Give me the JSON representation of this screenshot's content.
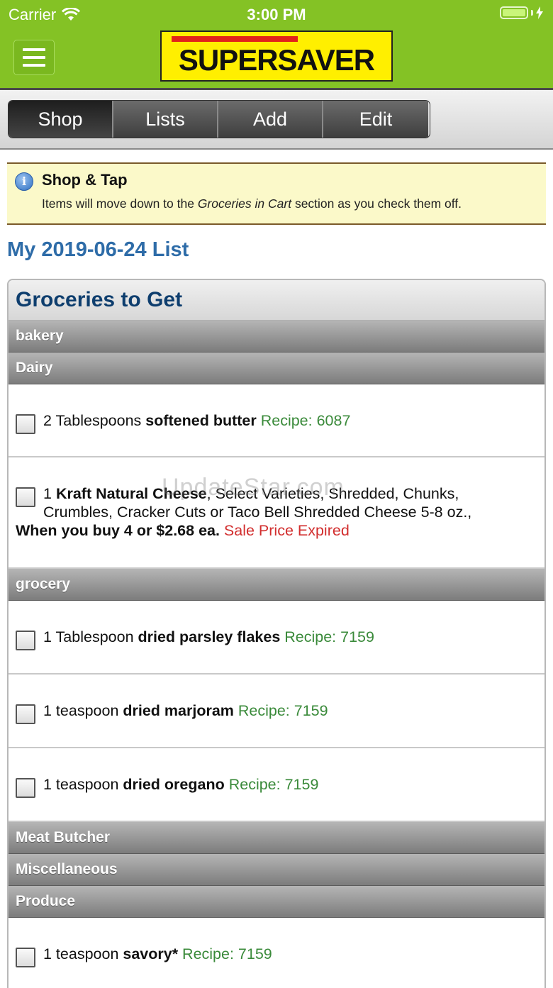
{
  "status_bar": {
    "carrier": "Carrier",
    "time": "3:00 PM",
    "wifi_icon": "wifi-icon",
    "battery_icon": "battery-charging-icon"
  },
  "header": {
    "menu_icon": "hamburger-menu-icon",
    "logo_text": "SUPERSAVER",
    "brand_color": "#84c225",
    "logo_color": "#ffef00"
  },
  "tabs": [
    {
      "label": "Shop",
      "active": true
    },
    {
      "label": "Lists",
      "active": false
    },
    {
      "label": "Add",
      "active": false
    },
    {
      "label": "Edit",
      "active": false
    }
  ],
  "info": {
    "icon": "info-icon",
    "title": "Shop & Tap",
    "text_before": "Items will move down to the ",
    "text_emphasis": "Groceries in Cart",
    "text_after": " section as you check them off."
  },
  "list_title": "My 2019-06-24 List",
  "panel_title": "Groceries to Get",
  "categories": {
    "bakery": "bakery",
    "dairy": "Dairy",
    "grocery": "grocery",
    "meat": "Meat Butcher",
    "misc": "Miscellaneous",
    "produce": "Produce"
  },
  "items": {
    "butter": {
      "qty": "2 Tablespoons ",
      "name": "softened butter",
      "recipe": " Recipe: 6087"
    },
    "cheese": {
      "qty": "1 ",
      "name": "Kraft Natural Cheese",
      "desc_line1": ", Select Varieties, Shredded, Chunks,",
      "desc_line2": "Crumbles, Cracker Cuts or Taco Bell Shredded Cheese 5-8 oz.,",
      "deal": "When you buy 4 or $2.68 ea.",
      "status": " Sale Price Expired"
    },
    "parsley": {
      "qty": "1 Tablespoon ",
      "name": "dried parsley flakes",
      "recipe": " Recipe: 7159"
    },
    "marjoram": {
      "qty": "1 teaspoon ",
      "name": "dried marjoram",
      "recipe": " Recipe: 7159"
    },
    "oregano": {
      "qty": "1 teaspoon ",
      "name": "dried oregano",
      "recipe": " Recipe: 7159"
    },
    "savory": {
      "qty": "1 teaspoon ",
      "name": "savory*",
      "recipe": " Recipe: 7159"
    }
  },
  "watermark": "UpdateStar.com"
}
